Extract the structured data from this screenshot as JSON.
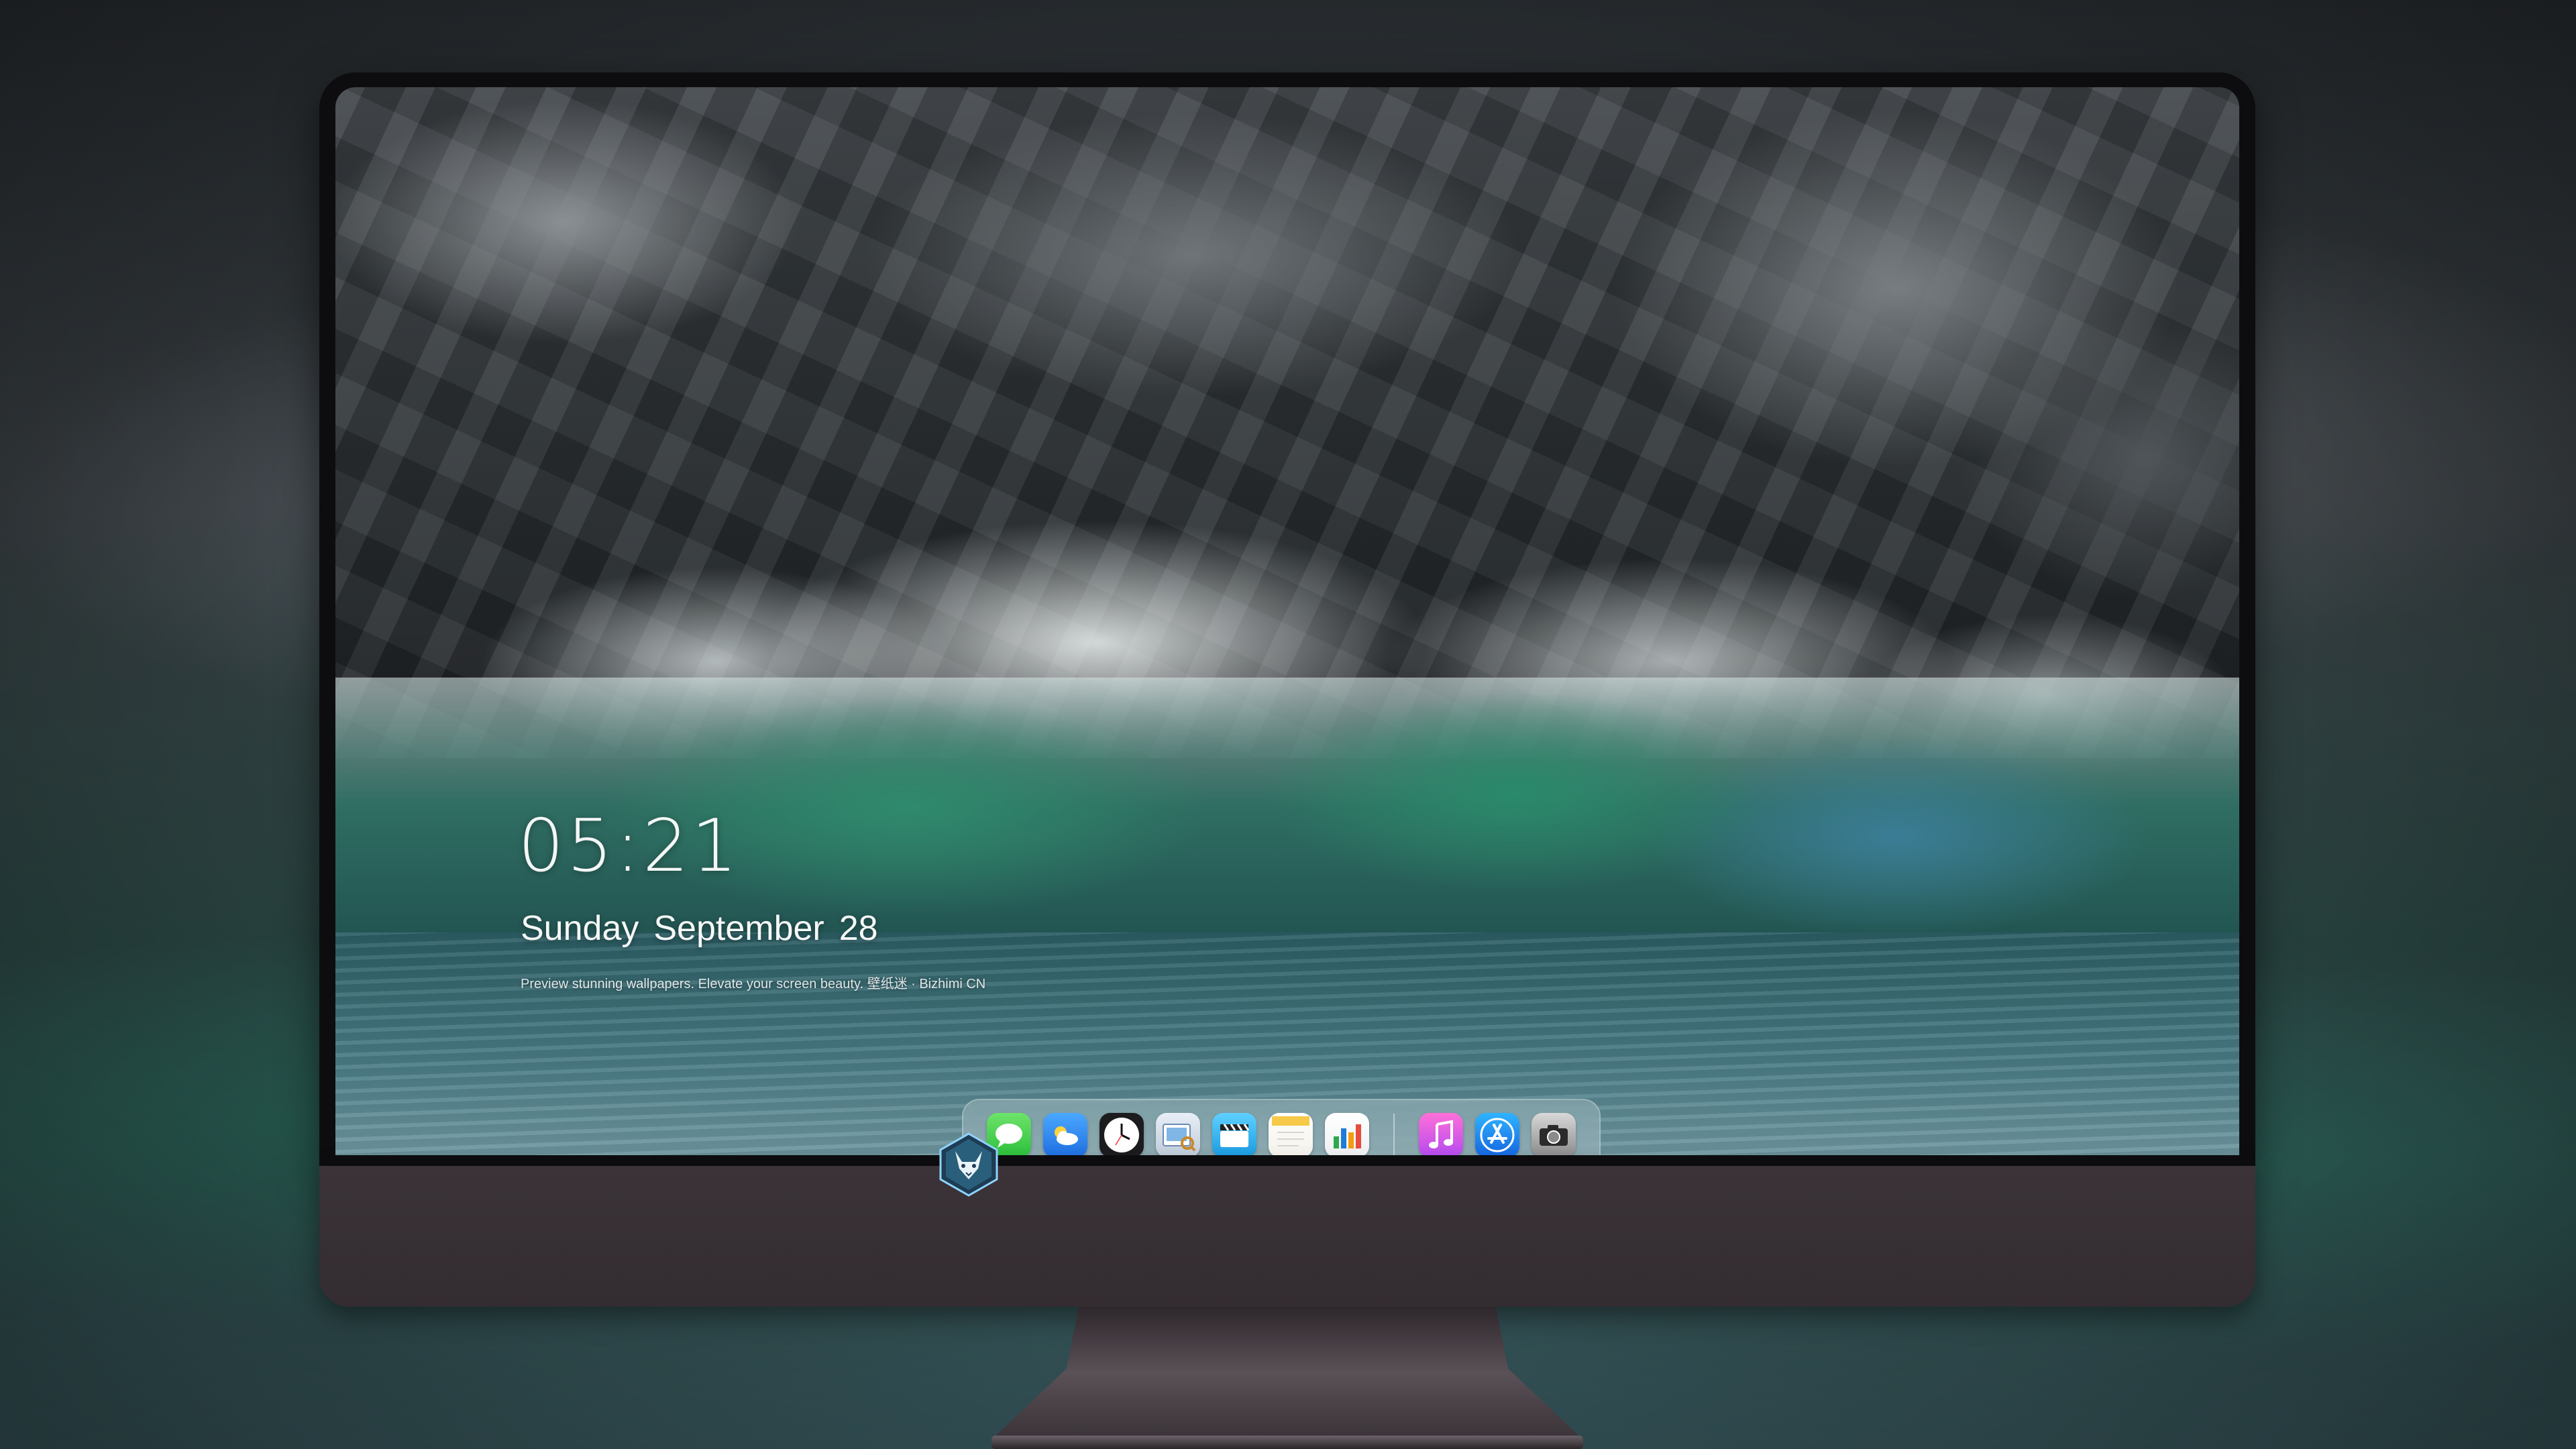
{
  "lockscreen": {
    "time": "05:21",
    "weekday": "Sunday",
    "month": "September",
    "day": "28",
    "caption": "Preview stunning wallpapers. Elevate your screen beauty. 壁纸迷 · Bizhimi CN"
  },
  "dock": {
    "apps": [
      {
        "name": "Messages",
        "icon": "messages-icon"
      },
      {
        "name": "Weather",
        "icon": "weather-icon"
      },
      {
        "name": "Clock",
        "icon": "clock-icon"
      },
      {
        "name": "Preview",
        "icon": "preview-icon"
      },
      {
        "name": "Clips",
        "icon": "clapperboard-icon"
      },
      {
        "name": "Notes",
        "icon": "notes-icon"
      },
      {
        "name": "Numbers",
        "icon": "numbers-icon"
      },
      {
        "name": "Music",
        "icon": "music-note-icon"
      },
      {
        "name": "App Store",
        "icon": "app-store-icon"
      },
      {
        "name": "Camera",
        "icon": "camera-icon"
      }
    ]
  },
  "colors": {
    "chin": "#3b3338",
    "bezel": "#0d0d0f",
    "wave_green": "#2f8a6c"
  }
}
